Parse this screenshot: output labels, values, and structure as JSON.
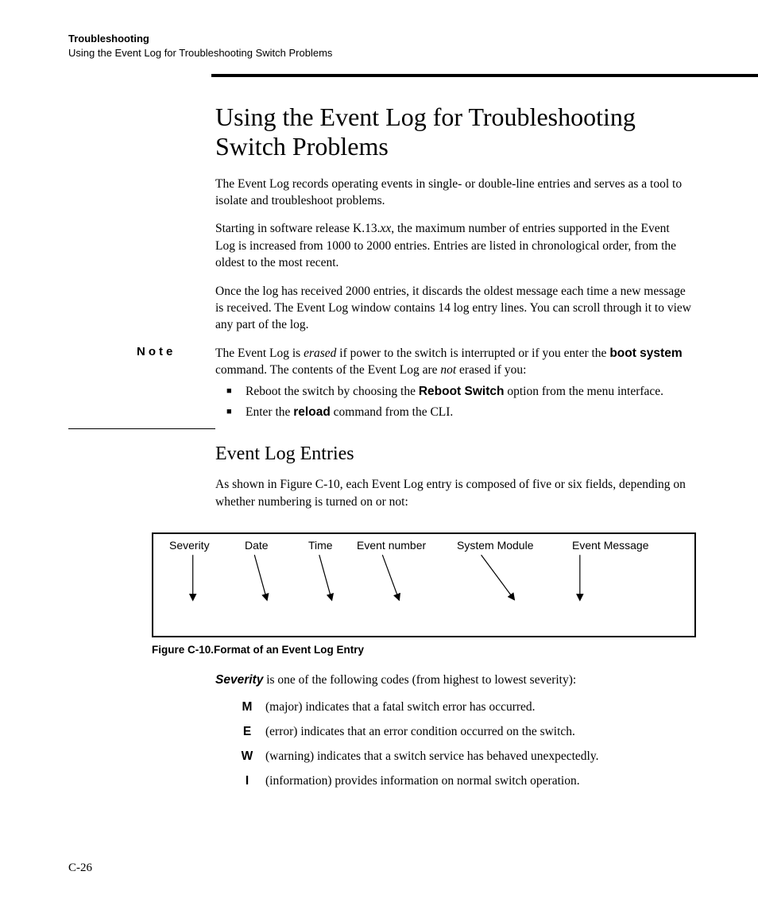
{
  "header": {
    "chapter": "Troubleshooting",
    "section": "Using the Event Log for Troubleshooting Switch Problems"
  },
  "title": "Using the Event Log for Troubleshooting Switch Problems",
  "intro": {
    "p1": "The Event Log records operating events in single- or double-line entries and serves as a tool to isolate and troubleshoot problems.",
    "p2a": "Starting in software release K.13.",
    "p2_release": "xx",
    "p2b": ", the maximum number of entries supported in the Event Log is increased from 1000 to 2000 entries. Entries are listed in chronological order, from the oldest to the most recent.",
    "p3": "Once the log has received 2000 entries, it discards the oldest message each time a new message is received. The Event Log window contains 14 log entry lines. You can scroll through it to view any part of the log."
  },
  "note": {
    "label": "Note",
    "lead_a": "The Event Log is ",
    "erased": "erased",
    "lead_b": " if power to the switch is interrupted or if you enter the ",
    "bootsystem": "boot system",
    "lead_c": " command. The contents of the Event Log are ",
    "not": "not",
    "lead_d": " erased if you:",
    "bullet1_a": "Reboot the switch by choosing the ",
    "bullet1_b": "Reboot Switch",
    "bullet1_c": " option from the menu interface.",
    "bullet2_a": "Enter the ",
    "bullet2_b": "reload",
    "bullet2_c": " command from the CLI."
  },
  "subhead": "Event Log Entries",
  "entries_intro": "As shown in Figure C-10, each Event Log entry is composed of five or six fields, depending on whether numbering is turned on or not:",
  "figure": {
    "labels": {
      "severity": "Severity",
      "date": "Date",
      "time": "Time",
      "eventnum": "Event number",
      "sys": "System Module",
      "msg": "Event Message"
    },
    "caption": "Figure C-10.Format of an Event Log Entry"
  },
  "severity": {
    "lead_label": "Severity",
    "lead_text": " is one of the following codes (from highest to lowest severity):",
    "items": [
      {
        "code": "M",
        "text": "(major) indicates that a fatal switch error has occurred."
      },
      {
        "code": "E",
        "text": "(error) indicates that an error condition occurred on the switch."
      },
      {
        "code": "W",
        "text": "(warning) indicates that a switch service has behaved unexpectedly."
      },
      {
        "code": "I",
        "text": "(information) provides information on normal switch operation."
      }
    ]
  },
  "page_number": "C-26"
}
